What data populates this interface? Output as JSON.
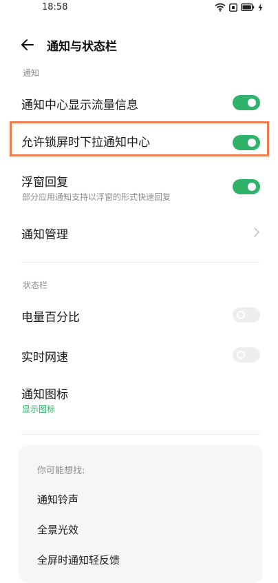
{
  "status_bar": {
    "time": "18:58"
  },
  "header": {
    "title": "通知与状态栏"
  },
  "sections": {
    "notification": "通知",
    "status_bar": "状态栏"
  },
  "rows": {
    "traffic_info": {
      "title": "通知中心显示流量信息",
      "toggle": "on"
    },
    "lockscreen_pulldown": {
      "title": "允许锁屏时下拉通知中心",
      "toggle": "on"
    },
    "floating_reply": {
      "title": "浮窗回复",
      "subtitle": "部分应用通知支持以浮窗的形式快速回复",
      "toggle": "on"
    },
    "notification_management": {
      "title": "通知管理"
    },
    "battery_percent": {
      "title": "电量百分比",
      "toggle": "off"
    },
    "realtime_speed": {
      "title": "实时网速",
      "toggle": "off"
    },
    "notification_icon": {
      "title": "通知图标",
      "subtitle": "显示图标"
    }
  },
  "suggestions": {
    "label": "你可能想找:",
    "items": [
      "通知铃声",
      "全景光效",
      "全屏时通知轻反馈"
    ]
  },
  "colors": {
    "toggle_on": "#2fb26a",
    "toggle_off": "#eeeeee",
    "highlight": "#f07a4a",
    "accent_text": "#2fb26a"
  }
}
